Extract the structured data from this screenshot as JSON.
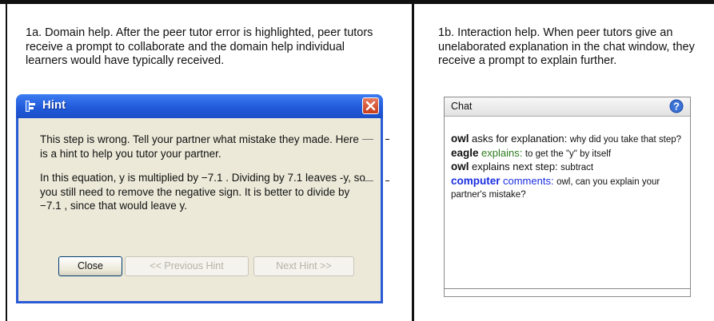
{
  "caption_a": "1a. Domain help. After the peer tutor error is highlighted, peer tutors receive a prompt to collaborate and the domain help individual learners would have typically received.",
  "caption_b": "1b. Interaction help. When peer tutors give an unelaborated explanation in the chat window, they receive a prompt to explain further.",
  "hint": {
    "title": "Hint",
    "paragraph1": "This step is wrong. Tell your partner what mistake they made. Here is a hint to help you tutor your partner.",
    "paragraph2": "In this equation, y is multiplied by −7.1 . Dividing by 7.1 leaves -y, so you still need to remove the negative sign. It is better to divide by −7.1 , since that would leave y.",
    "close_label": "Close",
    "previous_label": "<< Previous Hint",
    "next_label": "Next Hint >>"
  },
  "chat": {
    "header": "Chat",
    "messages": [
      {
        "name": "owl",
        "action": "asks for explanation:",
        "text": "why did you take that step?"
      },
      {
        "name": "eagle",
        "action": "explains:",
        "text": "to get the \"y\" by itself"
      },
      {
        "name": "owl",
        "action": "explains next step:",
        "text": "subtract"
      },
      {
        "name": "computer",
        "action": "comments:",
        "text": "owl, can you explain your partner's mistake?"
      }
    ]
  },
  "colors": {
    "title_bar": "#2058d8",
    "window_bg": "#ece9d8",
    "eagle_action": "#2e7d1e",
    "computer": "#1a2ee0"
  },
  "icons": [
    "hint-app-icon",
    "close-x-icon",
    "help-question-icon"
  ]
}
